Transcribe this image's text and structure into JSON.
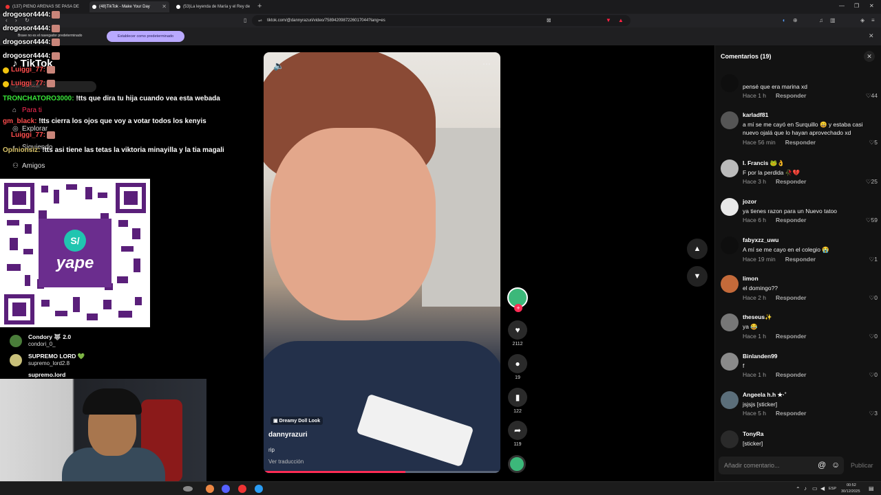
{
  "browser": {
    "tabs": [
      {
        "label": "(137) PIENO ARENAS SE PASA DE"
      },
      {
        "label": "(48)TikTok - Make Your Day"
      },
      {
        "label": "(53)La leyenda de María y el Rey de"
      }
    ],
    "url": "tiktok.com/@dannyrazuri/video/7589420987226017044?lang=es",
    "infobar_message": "Brave no es el navegador predeterminado",
    "infobar_button": "Establecer como predeterminado"
  },
  "tiktok_sidebar": {
    "logo": "TikTok",
    "search_placeholder": "Buscar",
    "nav": [
      "Para ti",
      "Explorar",
      "Siguiendo",
      "Amigos"
    ]
  },
  "stream_chat": [
    {
      "user": "drogosor4444:",
      "text": ""
    },
    {
      "user": "drogosor4444:",
      "text": ""
    },
    {
      "user": "drogosor4444:",
      "text": ""
    },
    {
      "user": "drogosor4444:",
      "text": ""
    },
    {
      "user": "Luiggi_77:",
      "text": ""
    },
    {
      "user": "Luiggi_77:",
      "text": ""
    },
    {
      "user": "TRONCHATORO3000:",
      "text": "!tts que dira tu hija cuando vea esta webada"
    },
    {
      "user": "gm_black:",
      "text": "!tts cierra los ojos que voy a votar todos los kenyis"
    },
    {
      "user": "Luiggi_77:",
      "text": ""
    },
    {
      "user": "Opinionsiz:",
      "text": "!tts asi tiene las tetas la viktoria minayilla y la tia magali"
    }
  ],
  "qr": {
    "brand": "yape"
  },
  "following": [
    {
      "name": "Condory 🐺 2.0",
      "handle": "condori_0_"
    },
    {
      "name": "SUPREMO LORD 💚",
      "handle": "supremo_lord2.8"
    },
    {
      "name": "supremo.lord",
      "handle": ""
    }
  ],
  "video": {
    "tag": "Dreamy Doll Look",
    "author": "dannyrazuri",
    "description": "rip",
    "translate": "Ver traducción",
    "progress": 0.6,
    "likes": "2112",
    "comments": "19",
    "saves": "122",
    "shares": "119"
  },
  "comments_panel": {
    "title": "Comentarios (19)",
    "reply_label": "Responder",
    "items": [
      {
        "user": "",
        "text": "pensé que era marina xd",
        "time": "Hace 1 h",
        "likes": "44"
      },
      {
        "user": "karladf81",
        "text": "a mí se me cayó en Surquillo 😄 y estaba casi nuevo ojalá que lo hayan aprovechado xd",
        "time": "Hace 56 min",
        "likes": "5"
      },
      {
        "user": "I. Francis 🐸👌",
        "text": "F por la perdida 🥀💔",
        "time": "Hace 3 h",
        "likes": "25"
      },
      {
        "user": "jozor",
        "text": "ya tienes razon para un Nuevo tatoo",
        "time": "Hace 6 h",
        "likes": "59"
      },
      {
        "user": "fabyxzz_uwu",
        "text": "A mí se me cayo en el colegio 😭",
        "time": "Hace 19 min",
        "likes": "1"
      },
      {
        "user": "limon",
        "text": "el domingo??",
        "time": "Hace 2 h",
        "likes": "0"
      },
      {
        "user": "theseus✨",
        "text": "ya 😂",
        "time": "Hace 1 h",
        "likes": "0"
      },
      {
        "user": "Binlanden99",
        "text": "f",
        "time": "Hace 1 h",
        "likes": "0"
      },
      {
        "user": "Angeela h.h ★·˚",
        "text": "jsjsjs [sticker]",
        "time": "Hace 5 h",
        "likes": "3"
      },
      {
        "user": "TonyRa",
        "text": "[sticker]",
        "time": "",
        "likes": ""
      }
    ],
    "input_placeholder": "Añadir comentario...",
    "publish": "Publicar"
  },
  "taskbar": {
    "lang": "ESP",
    "time": "00:52",
    "date": "30/12/2025"
  }
}
